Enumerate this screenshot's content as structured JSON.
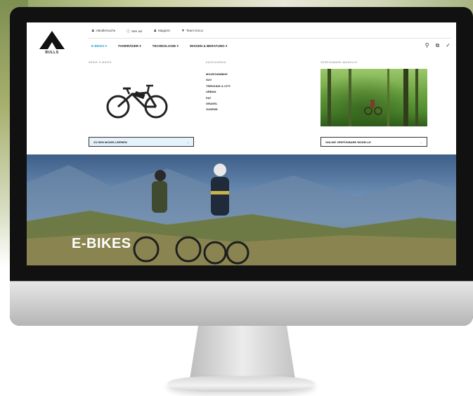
{
  "top_links": [
    {
      "label": "Händlersuche",
      "icon": "person-icon"
    },
    {
      "label": "Wer wir",
      "icon": "info-icon"
    },
    {
      "label": "Magazin",
      "icon": "person-icon"
    },
    {
      "label": "Team KULU",
      "icon": "trophy-icon"
    }
  ],
  "logo": {
    "text": "BULLS"
  },
  "main_nav": [
    {
      "label": "E-BIKES",
      "active": true
    },
    {
      "label": "FAHRRÄDER",
      "active": false
    },
    {
      "label": "TECHNOLOGIE",
      "active": false
    },
    {
      "label": "WISSEN & BERATUNG",
      "active": false
    }
  ],
  "mega_menu": {
    "col1_heading": "SERIE E-BIKES",
    "col2_heading": "KATEGORIEN",
    "col3_heading": "VERFÜGBARE MODELLE",
    "categories": [
      "MOUNTAINBIKE",
      "SUV",
      "TREKKING & CITY",
      "URBAN",
      "FAT",
      "GRAVEL",
      "JUGEND"
    ],
    "cta_left": "ZU DEN MODELLSERIEN",
    "cta_right": "ONLINE VERFÜGBARE MODELLE",
    "arrow": "→"
  },
  "hero": {
    "title": "E-BIKES"
  },
  "colors": {
    "accent": "#1aa3d4",
    "cta_fill": "#e4f3fb"
  }
}
